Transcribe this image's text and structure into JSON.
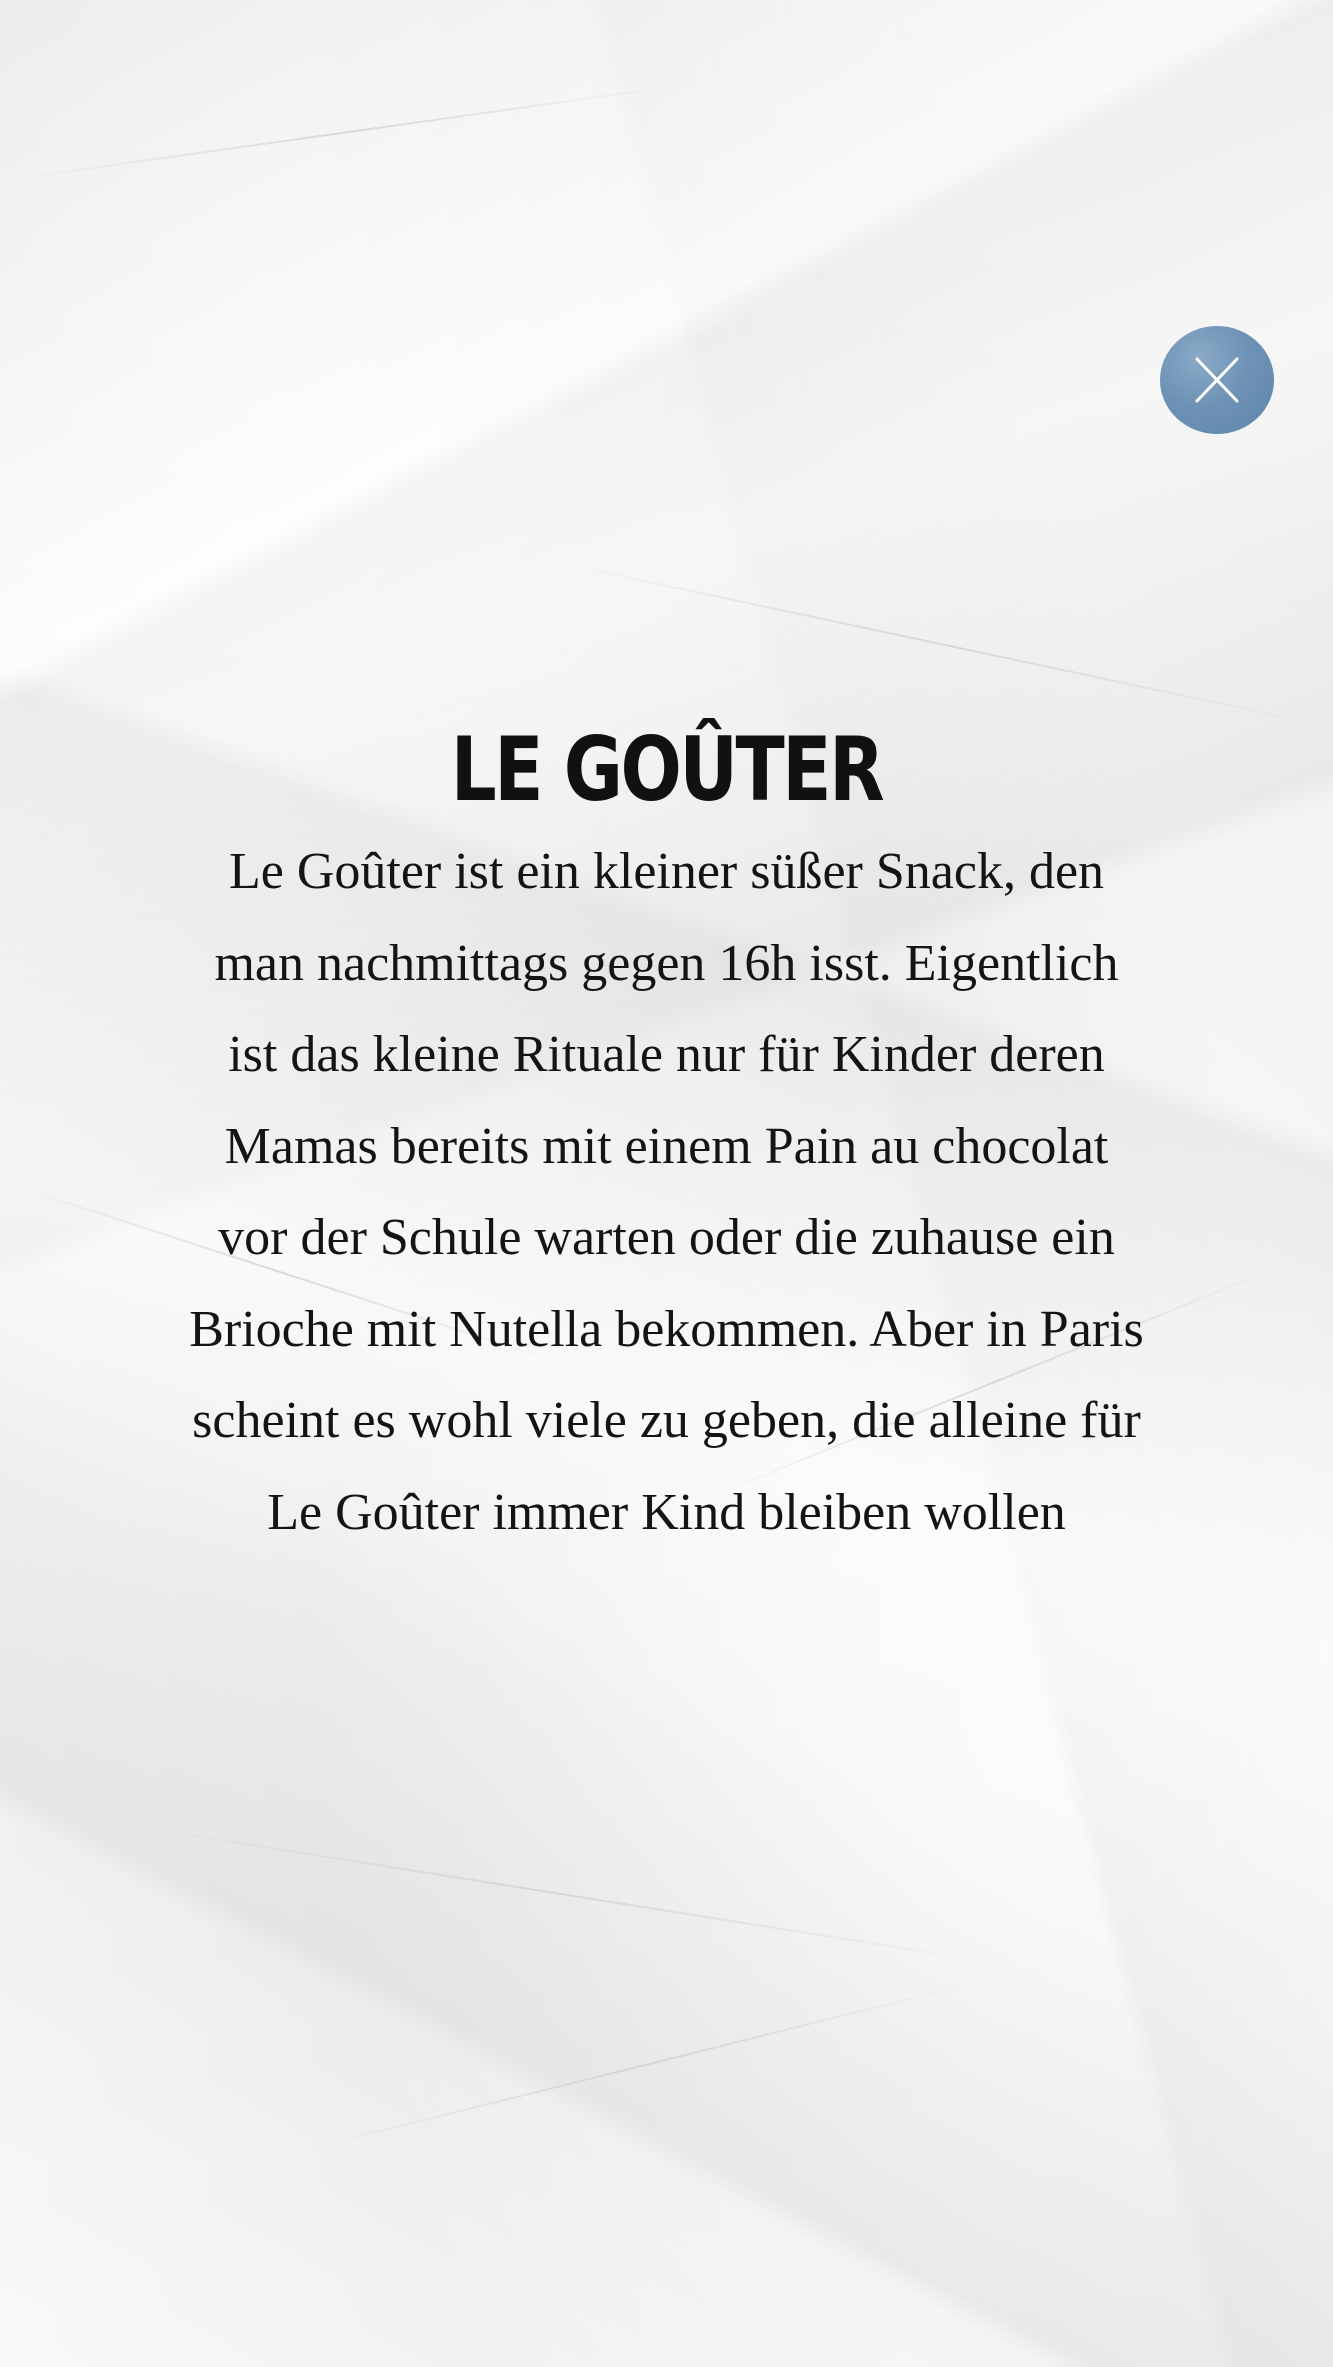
{
  "close_button": {
    "icon": "close-icon",
    "color": "#6f93b6"
  },
  "article": {
    "title": "Le Goûter",
    "lines": [
      "Le Goûter ist ein kleiner süßer Snack, den",
      "man nachmittags gegen 16h isst. Eigentlich",
      "ist das kleine Rituale nur für Kinder deren",
      "Mamas bereits mit einem Pain au chocolat",
      "vor der Schule warten oder die zuhause ein",
      "Brioche mit Nutella bekommen. Aber in Paris",
      "scheint es wohl viele zu geben, die alleine für",
      "Le Goûter immer Kind bleiben wollen"
    ]
  }
}
